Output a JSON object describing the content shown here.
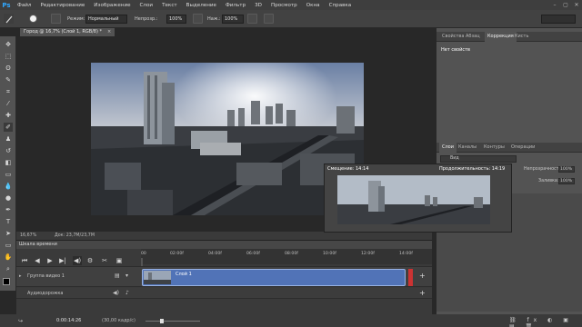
{
  "menu": {
    "logo": "Ps",
    "items": [
      "Файл",
      "Редактирование",
      "Изображение",
      "Слои",
      "Текст",
      "Выделение",
      "Фильтр",
      "3D",
      "Просмотр",
      "Окна",
      "Справка"
    ]
  },
  "options": {
    "mode_label": "Режим:",
    "mode_value": "Нормальный",
    "opacity_label": "Непрозр.:",
    "opacity_value": "100%",
    "pressure_label": "Наж.:",
    "pressure_value": "100%"
  },
  "document": {
    "tab_title": "Город @ 16,7% (Слой 1, RGB/8) *",
    "close": "×",
    "zoom": "16,67%",
    "doc_info": "Док: 23,7М/23,7М"
  },
  "right_top": {
    "tabs": [
      "Свойства",
      "Абзац",
      "Коррекция",
      "Кисть"
    ],
    "active_tab_index": 2,
    "properties_title": "Нет свойств"
  },
  "right_layers": {
    "tabs": [
      "Слои",
      "Каналы",
      "Контуры",
      "Операции"
    ],
    "kind_filter": "Вид",
    "opacity_label": "Непрозрачность:",
    "opacity_value": "100%",
    "fill_label": "Заливка:",
    "fill_value": "100%"
  },
  "preview": {
    "offset_label": "Смещение: 14:14",
    "duration_label": "Продолжительность: 14:19"
  },
  "timeline": {
    "title": "Шкала времени",
    "ruler_ticks": [
      "00",
      "02:00f",
      "04:00f",
      "06:00f",
      "08:00f",
      "10:00f",
      "12:00f",
      "14:00f"
    ],
    "video_group": "Группа видео 1",
    "clip_label": "Слой 1",
    "audio_track": "Аудиодорожка",
    "current_time": "0:00:14:26",
    "fps": "(30,00 кадр/с)"
  },
  "colors": {
    "accent": "#31a8ff",
    "clip": "#5173b7",
    "panel": "#535353",
    "bg": "#282828"
  }
}
